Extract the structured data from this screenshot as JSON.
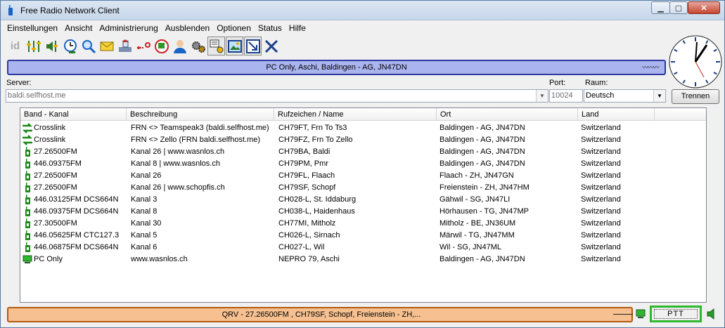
{
  "window": {
    "title": "Free Radio Network Client"
  },
  "menu": [
    {
      "label": "Einstellungen"
    },
    {
      "label": "Ansicht"
    },
    {
      "label": "Administrierung"
    },
    {
      "label": "Ausblenden"
    },
    {
      "label": "Optionen"
    },
    {
      "label": "Status"
    },
    {
      "label": "Hilfe"
    }
  ],
  "toolbar": {
    "icons": [
      "id-icon",
      "equalizer-icon",
      "speaker-volume-icon",
      "clock-icon",
      "search-icon",
      "mail-icon",
      "upload-icon",
      "connection-icon",
      "power-icon",
      "user-icon",
      "gears-icon",
      "settings-icon",
      "picture-icon",
      "resize-icon",
      "close-x-icon"
    ],
    "id_label": "id"
  },
  "banner": {
    "text": "PC Only, Aschi, Baldingen - AG, JN47DN"
  },
  "server": {
    "label": "Server:",
    "value": "baldi.selfhost.me"
  },
  "port": {
    "label": "Port:",
    "value": "10024"
  },
  "room": {
    "label": "Raum:",
    "value": "Deutsch"
  },
  "disconnect_button": {
    "label": "Trennen"
  },
  "columns": [
    "Band - Kanal",
    "Beschreibung",
    "Rufzeichen / Name",
    "Ort",
    "Land"
  ],
  "rows": [
    {
      "icon": "crosslink-icon",
      "band": "Crosslink",
      "desc": "FRN <> Teamspeak3 (baldi.selfhost.me)",
      "call": "CH79FT, Frn To Ts3",
      "ort": "Baldingen - AG, JN47DN",
      "land": "Switzerland"
    },
    {
      "icon": "crosslink-icon",
      "band": "Crosslink",
      "desc": "FRN <> Zello (FRN baldi.selfhost.me)",
      "call": "CH79FZ, Frn To Zello",
      "ort": "Baldingen - AG, JN47DN",
      "land": "Switzerland"
    },
    {
      "icon": "radio-icon",
      "band": " 27.26500FM",
      "desc": "Kanal 26 | www.wasnlos.ch",
      "call": "CH79BA, Baldi",
      "ort": "Baldingen - AG, JN47DN",
      "land": "Switzerland"
    },
    {
      "icon": "radio-icon",
      "band": "446.09375FM",
      "desc": "Kanal 8 | www.wasnlos.ch",
      "call": "CH79PM, Pmr",
      "ort": "Baldingen - AG, JN47DN",
      "land": "Switzerland"
    },
    {
      "icon": "radio-icon",
      "band": " 27.26500FM",
      "desc": "Kanal 26",
      "call": "CH79FL, Flaach",
      "ort": "Flaach - ZH, JN47GN",
      "land": "Switzerland"
    },
    {
      "icon": "radio-icon",
      "band": " 27.26500FM",
      "desc": "Kanal 26 | www.schopfis.ch",
      "call": "CH79SF, Schopf",
      "ort": "Freienstein - ZH, JN47HM",
      "land": "Switzerland"
    },
    {
      "icon": "radio-icon",
      "band": "446.03125FM DCS664N",
      "desc": "Kanal 3",
      "call": "CH028-L, St. Iddaburg",
      "ort": "Gähwil - SG, JN47LI",
      "land": "Switzerland"
    },
    {
      "icon": "radio-icon",
      "band": "446.09375FM DCS664N",
      "desc": "Kanal 8",
      "call": "CH038-L, Haidenhaus",
      "ort": "Hörhausen - TG, JN47MP",
      "land": "Switzerland"
    },
    {
      "icon": "radio-icon",
      "band": " 27.30500FM",
      "desc": "Kanal 30",
      "call": "CH77MI, Mitholz",
      "ort": "Mitholz - BE, JN36UM",
      "land": "Switzerland"
    },
    {
      "icon": "radio-icon",
      "band": "446.05625FM CTC127.3",
      "desc": "Kanal 5",
      "call": "CH026-L, Sirnach",
      "ort": "Märwil - TG, JN47MM",
      "land": "Switzerland"
    },
    {
      "icon": "radio-icon",
      "band": "446.06875FM DCS664N",
      "desc": "Kanal 6",
      "call": "CH027-L, Wil",
      "ort": "Wil - SG, JN47ML",
      "land": "Switzerland"
    },
    {
      "icon": "pc-icon",
      "band": "PC Only",
      "desc": "www.wasnlos.ch",
      "call": "NEPRO 79, Aschi",
      "ort": "Baldingen - AG, JN47DN",
      "land": "Switzerland"
    }
  ],
  "status": {
    "text": "QRV -  27.26500FM , CH79SF, Schopf, Freienstein - ZH,..."
  },
  "ptt": {
    "label": "PTT"
  },
  "colors": {
    "banner_bg": "#aab4ee",
    "banner_border": "#2e3aa0",
    "status_bg": "#f6c090",
    "status_border": "#b35a10",
    "ptt_border": "#2eb82e"
  }
}
